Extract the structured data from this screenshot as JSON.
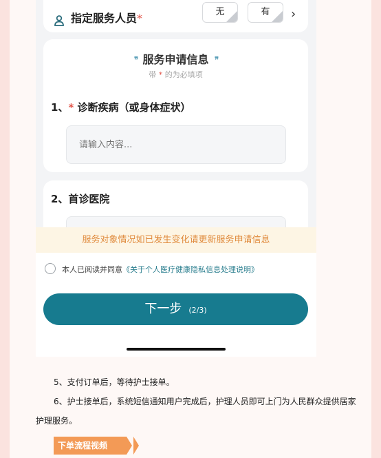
{
  "form": {
    "staff_label": "指定服务人员",
    "required_mark": "*",
    "options": [
      "无",
      "有"
    ],
    "chevron": "›"
  },
  "section": {
    "quote_left": "❜❜",
    "title": "服务申请信息",
    "quote_right": "❜❜",
    "subtitle_prefix": "带",
    "subtitle_mark": "*",
    "subtitle_suffix": "的为必填项"
  },
  "q1": {
    "prefix": "1、",
    "mark": "*",
    "label": "诊断疾病（或身体症状）",
    "placeholder": "请输入内容..."
  },
  "q2": {
    "label": "2、首诊医院"
  },
  "notice": "服务对象情况如已发生变化请更新服务申请信息",
  "agree": {
    "text": "本人已阅读并同意",
    "link": "《关于个人医疗健康隐私信息处理说明》"
  },
  "next_button": {
    "label": "下一步",
    "step": "(2/3)"
  },
  "article": {
    "p5": "5、支付订单后，等待护士接单。",
    "p6": "6、护士接单后，系统短信通知用户完成后，护理人员即可上门为人民群众提供居家护理服务。",
    "badge": "下单流程视频"
  },
  "colors": {
    "primary": "#177b8f",
    "required": "#e2554a",
    "notice_text": "#e08a3c",
    "notice_bg": "#fdf5e4",
    "badge": "#f39a56",
    "page_bg": "#fbe3df"
  },
  "icons": [
    "person-icon",
    "chevron-right-icon",
    "radio-icon",
    "quote-icon"
  ]
}
